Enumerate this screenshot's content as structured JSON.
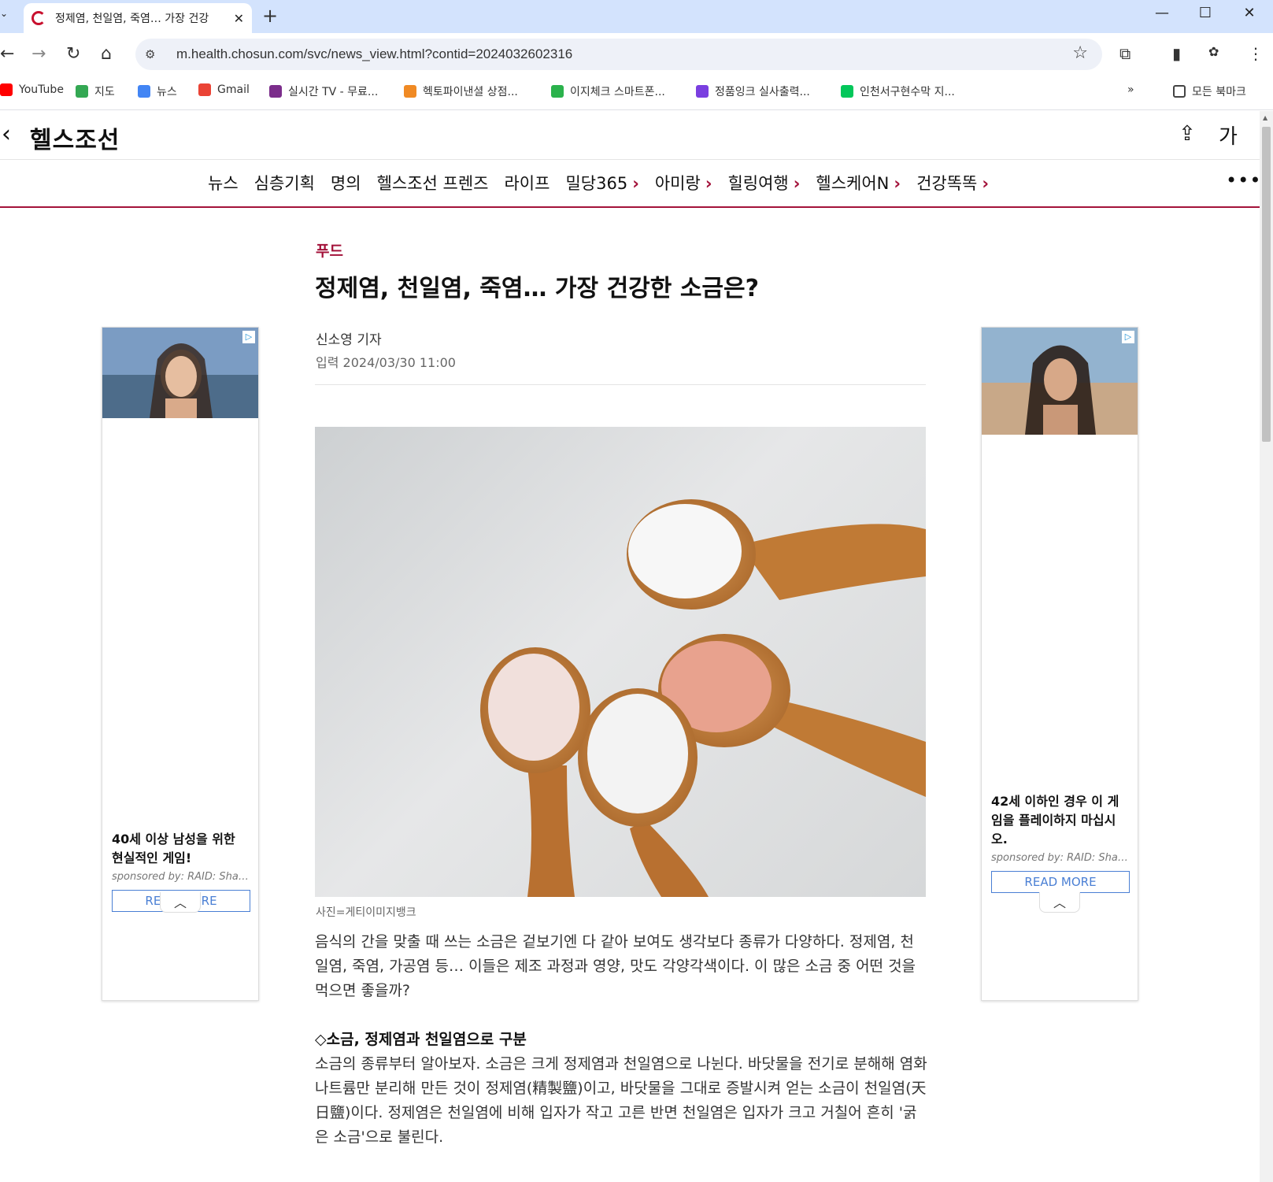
{
  "browser": {
    "tab_title": "정제염, 천일염, 죽염… 가장 건강",
    "url": "m.health.chosun.com/svc/news_view.html?contid=2024032602316",
    "bookmarks": [
      {
        "label": "YouTube",
        "color": "#ff0000"
      },
      {
        "label": "지도",
        "color": "#34a853"
      },
      {
        "label": "뉴스",
        "color": "#4285f4"
      },
      {
        "label": "Gmail",
        "color": "#ea4335"
      },
      {
        "label": "실시간 TV - 무료...",
        "color": "#7b2d8b"
      },
      {
        "label": "헥토파이낸셜 상점...",
        "color": "#f08a24"
      },
      {
        "label": "이지체크 스마트폰...",
        "color": "#2bb24c"
      },
      {
        "label": "정품잉크 실사출력...",
        "color": "#7a3fe0"
      },
      {
        "label": "인천서구현수막 지...",
        "color": "#03c75a"
      }
    ],
    "all_bookmarks": "모든 북마크"
  },
  "site": {
    "logo": "헬스조선",
    "font_size_btn": "가",
    "menu": [
      {
        "label": "뉴스",
        "chevron": false
      },
      {
        "label": "심층기획",
        "chevron": false
      },
      {
        "label": "명의",
        "chevron": false
      },
      {
        "label": "헬스조선 프렌즈",
        "chevron": false
      },
      {
        "label": "라이프",
        "chevron": false
      },
      {
        "label": "밀당365",
        "chevron": true
      },
      {
        "label": "아미랑",
        "chevron": true
      },
      {
        "label": "힐링여행",
        "chevron": true
      },
      {
        "label": "헬스케어N",
        "chevron": true
      },
      {
        "label": "건강똑똑",
        "chevron": true
      }
    ]
  },
  "article": {
    "category": "푸드",
    "headline": "정제염, 천일염, 죽염… 가장 건강한 소금은?",
    "byline": "신소영 기자",
    "date": "입력 2024/03/30 11:00",
    "photo_caption": "사진=게티이미지뱅크",
    "intro": "음식의 간을 맞출 때 쓰는 소금은 겉보기엔 다 같아 보여도 생각보다 종류가 다양하다. 정제염, 천일염, 죽염, 가공염 등… 이들은 제조 과정과 영양, 맛도 각양각색이다. 이 많은 소금 중 어떤 것을 먹으면 좋을까?",
    "section_heading": "◇소금, 정제염과 천일염으로 구분",
    "section_body": "소금의 종류부터 알아보자. 소금은 크게 정제염과 천일염으로 나뉜다. 바닷물을 전기로 분해해 염화나트륨만 분리해 만든 것이 정제염(精製鹽)이고, 바닷물을 그대로 증발시켜 얻는 소금이 천일염(天日鹽)이다. 정제염은 천일염에 비해 입자가 작고 고른 반면 천일염은 입자가 크고 거칠어 흔히 '굵은 소금'으로 불린다."
  },
  "ads": {
    "left": {
      "headline": "40세 이상 남성을 위한 현실적인 게임!",
      "sponsor": "sponsored by: RAID: Shadow Legends",
      "cta": "READ MORE"
    },
    "right": {
      "headline": "42세 이하인 경우 이 게임을 플레이하지 마십시오.",
      "sponsor": "sponsored by: RAID: Shadow Legends",
      "cta": "READ MORE"
    }
  }
}
